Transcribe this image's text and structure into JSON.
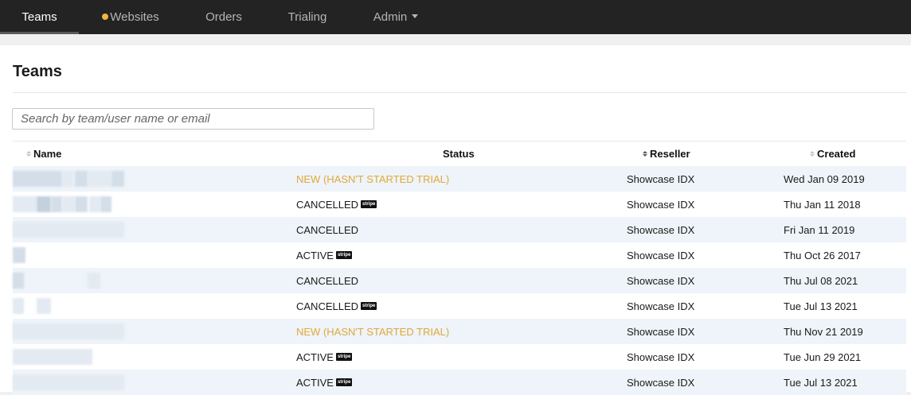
{
  "nav": {
    "items": [
      {
        "label": "Teams",
        "active": true
      },
      {
        "label": "Websites",
        "has_dot": true
      },
      {
        "label": "Orders"
      },
      {
        "label": "Trialing"
      },
      {
        "label": "Admin",
        "has_caret": true
      }
    ]
  },
  "page": {
    "title": "Teams",
    "search_placeholder": "Search by team/user name or email"
  },
  "table": {
    "columns": [
      {
        "label": "Name",
        "sortable": true,
        "sorted": false
      },
      {
        "label": "Status",
        "sortable": false
      },
      {
        "label": "Reseller",
        "sortable": true,
        "sorted": true
      },
      {
        "label": "Created",
        "sortable": true,
        "sorted": false
      }
    ],
    "stripe_label": "stripe",
    "rows": [
      {
        "status": "NEW (HASN'T STARTED TRIAL)",
        "status_type": "new",
        "stripe": false,
        "reseller": "Showcase IDX",
        "created": "Wed Jan 09 2019"
      },
      {
        "status": "CANCELLED",
        "status_type": "normal",
        "stripe": true,
        "reseller": "Showcase IDX",
        "created": "Thu Jan 11 2018"
      },
      {
        "status": "CANCELLED",
        "status_type": "normal",
        "stripe": false,
        "reseller": "Showcase IDX",
        "created": "Fri Jan 11 2019"
      },
      {
        "status": "ACTIVE",
        "status_type": "normal",
        "stripe": true,
        "reseller": "Showcase IDX",
        "created": "Thu Oct 26 2017"
      },
      {
        "status": "CANCELLED",
        "status_type": "normal",
        "stripe": false,
        "reseller": "Showcase IDX",
        "created": "Thu Jul 08 2021"
      },
      {
        "status": "CANCELLED",
        "status_type": "normal",
        "stripe": true,
        "reseller": "Showcase IDX",
        "created": "Tue Jul 13 2021"
      },
      {
        "status": "NEW (HASN'T STARTED TRIAL)",
        "status_type": "new",
        "stripe": false,
        "reseller": "Showcase IDX",
        "created": "Thu Nov 21 2019"
      },
      {
        "status": "ACTIVE",
        "status_type": "normal",
        "stripe": true,
        "reseller": "Showcase IDX",
        "created": "Tue Jun 29 2021"
      },
      {
        "status": "ACTIVE",
        "status_type": "normal",
        "stripe": true,
        "reseller": "Showcase IDX",
        "created": "Tue Jul 13 2021"
      }
    ]
  },
  "colors": {
    "nav_bg": "#232323",
    "row_stripe": "#eef4f9",
    "status_new": "#e2a83a",
    "dot": "#f0b73a"
  }
}
